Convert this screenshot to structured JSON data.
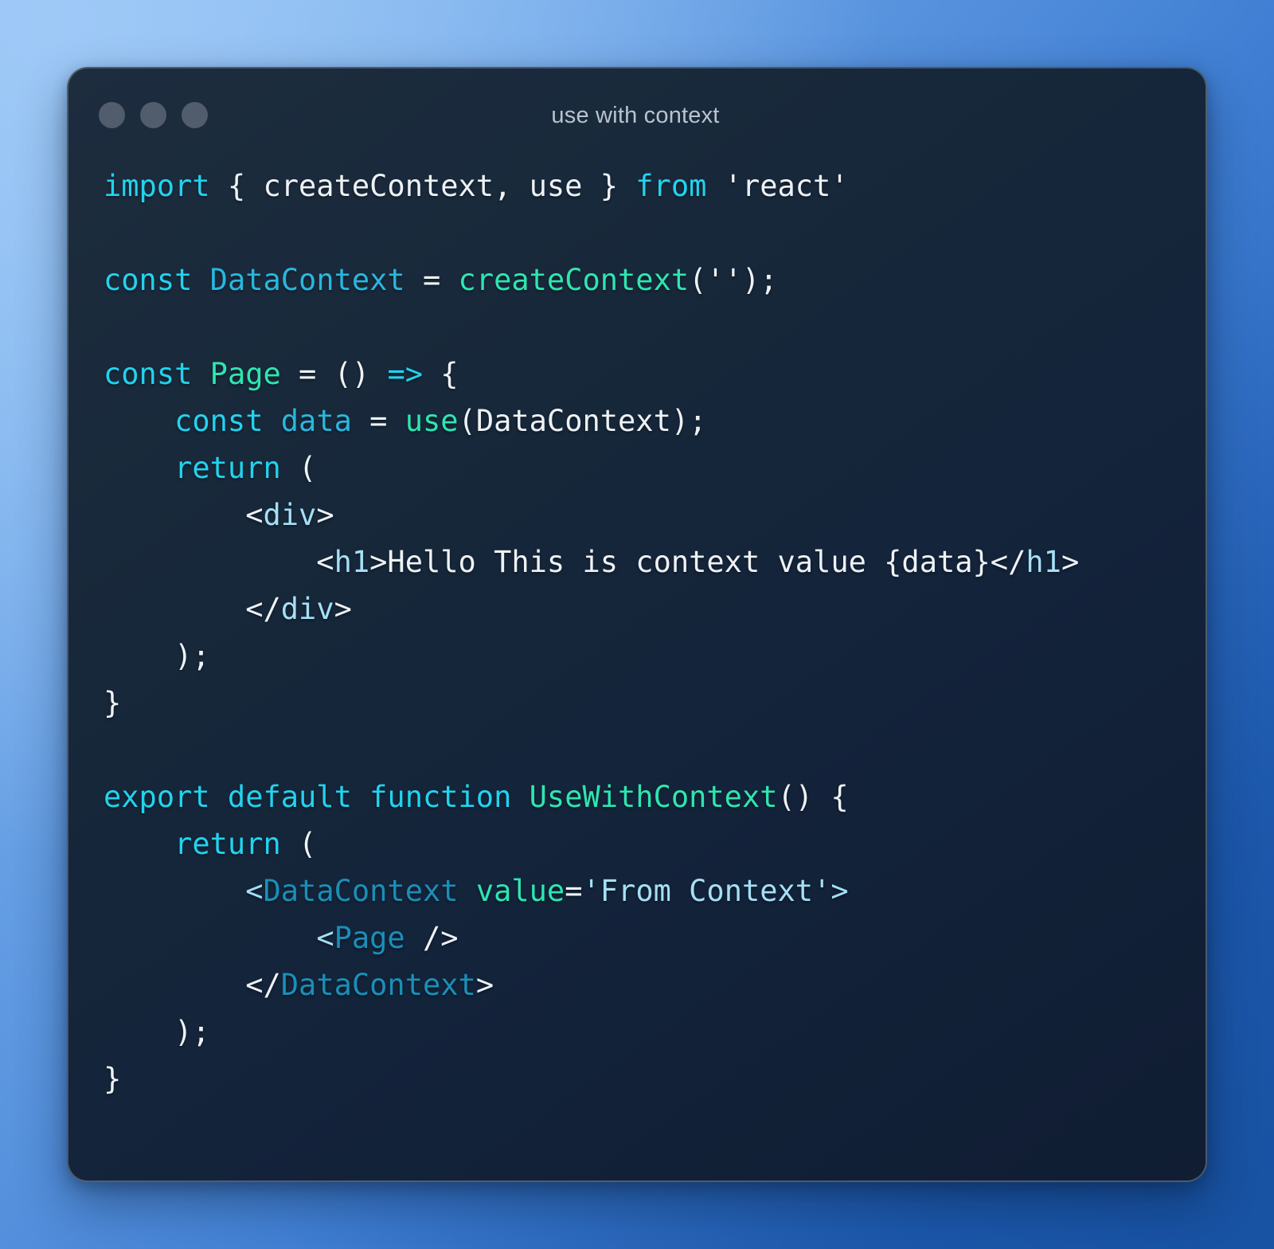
{
  "window": {
    "title": "use with context",
    "traffic_lights": [
      "close-dot",
      "minimize-dot",
      "maximize-dot"
    ]
  },
  "colors": {
    "window_bg": "#17283a",
    "backdrop_from": "#8cbdf2",
    "backdrop_to": "#1a56ad",
    "dot": "#515d6c",
    "title_text": "#b9c3ce",
    "keyword": "#22d3ee",
    "function": "#2ee6b0",
    "variable": "#2ab7dd",
    "jsx_tag": "#a5dff5",
    "jsx_component": "#1a8fb8",
    "plain": "#eef2f6"
  },
  "code": {
    "language": "jsx",
    "plain_text": "import { createContext, use } from 'react'\n\nconst DataContext = createContext('');\n\nconst Page = () => {\n    const data = use(DataContext);\n    return (\n        <div>\n            <h1>Hello This is context value {data}</h1>\n        </div>\n    );\n}\n\nexport default function UseWithContext() {\n    return (\n        <DataContext value='From Context'>\n            <Page />\n        </DataContext>\n    );\n}",
    "lines": [
      {
        "n": 1,
        "tokens": [
          {
            "t": "import",
            "c": "tok-kw"
          },
          {
            "t": " { createContext, use } ",
            "c": "tok-plain"
          },
          {
            "t": "from",
            "c": "tok-kw"
          },
          {
            "t": " 'react'",
            "c": "tok-plain"
          }
        ]
      },
      {
        "n": 2,
        "tokens": []
      },
      {
        "n": 3,
        "tokens": [
          {
            "t": "const",
            "c": "tok-kw"
          },
          {
            "t": " ",
            "c": "tok-plain"
          },
          {
            "t": "DataContext",
            "c": "tok-var"
          },
          {
            "t": " = ",
            "c": "tok-plain"
          },
          {
            "t": "createContext",
            "c": "tok-fn"
          },
          {
            "t": "('');",
            "c": "tok-plain"
          }
        ]
      },
      {
        "n": 4,
        "tokens": []
      },
      {
        "n": 5,
        "tokens": [
          {
            "t": "const",
            "c": "tok-kw"
          },
          {
            "t": " ",
            "c": "tok-plain"
          },
          {
            "t": "Page",
            "c": "tok-fn"
          },
          {
            "t": " = () ",
            "c": "tok-plain"
          },
          {
            "t": "=>",
            "c": "tok-kw"
          },
          {
            "t": " {",
            "c": "tok-plain"
          }
        ]
      },
      {
        "n": 6,
        "tokens": [
          {
            "t": "    ",
            "c": "tok-plain"
          },
          {
            "t": "const",
            "c": "tok-kw"
          },
          {
            "t": " ",
            "c": "tok-plain"
          },
          {
            "t": "data",
            "c": "tok-var"
          },
          {
            "t": " = ",
            "c": "tok-plain"
          },
          {
            "t": "use",
            "c": "tok-fn"
          },
          {
            "t": "(DataContext);",
            "c": "tok-plain"
          }
        ]
      },
      {
        "n": 7,
        "tokens": [
          {
            "t": "    ",
            "c": "tok-plain"
          },
          {
            "t": "return",
            "c": "tok-kw"
          },
          {
            "t": " (",
            "c": "tok-plain"
          }
        ]
      },
      {
        "n": 8,
        "tokens": [
          {
            "t": "        <",
            "c": "tok-plain"
          },
          {
            "t": "div",
            "c": "tok-tag"
          },
          {
            "t": ">",
            "c": "tok-plain"
          }
        ]
      },
      {
        "n": 9,
        "tokens": [
          {
            "t": "            <",
            "c": "tok-plain"
          },
          {
            "t": "h1",
            "c": "tok-tag"
          },
          {
            "t": ">Hello This is context value {data}</",
            "c": "tok-plain"
          },
          {
            "t": "h1",
            "c": "tok-tag"
          },
          {
            "t": ">",
            "c": "tok-plain"
          }
        ]
      },
      {
        "n": 10,
        "tokens": [
          {
            "t": "        </",
            "c": "tok-plain"
          },
          {
            "t": "div",
            "c": "tok-tag"
          },
          {
            "t": ">",
            "c": "tok-plain"
          }
        ]
      },
      {
        "n": 11,
        "tokens": [
          {
            "t": "    );",
            "c": "tok-plain"
          }
        ]
      },
      {
        "n": 12,
        "tokens": [
          {
            "t": "}",
            "c": "tok-plain"
          }
        ]
      },
      {
        "n": 13,
        "tokens": []
      },
      {
        "n": 14,
        "tokens": [
          {
            "t": "export default function",
            "c": "tok-kw"
          },
          {
            "t": " ",
            "c": "tok-plain"
          },
          {
            "t": "UseWithContext",
            "c": "tok-fn"
          },
          {
            "t": "() {",
            "c": "tok-plain"
          }
        ]
      },
      {
        "n": 15,
        "tokens": [
          {
            "t": "    ",
            "c": "tok-plain"
          },
          {
            "t": "return",
            "c": "tok-kw"
          },
          {
            "t": " (",
            "c": "tok-plain"
          }
        ]
      },
      {
        "n": 16,
        "tokens": [
          {
            "t": "        ",
            "c": "tok-plain"
          },
          {
            "t": "<",
            "c": "tok-tag"
          },
          {
            "t": "DataContext",
            "c": "tok-comp"
          },
          {
            "t": " ",
            "c": "tok-plain"
          },
          {
            "t": "value",
            "c": "tok-attr"
          },
          {
            "t": "=",
            "c": "tok-plain"
          },
          {
            "t": "'From Context'",
            "c": "tok-tag"
          },
          {
            "t": ">",
            "c": "tok-tag"
          }
        ]
      },
      {
        "n": 17,
        "tokens": [
          {
            "t": "            ",
            "c": "tok-plain"
          },
          {
            "t": "<",
            "c": "tok-tag"
          },
          {
            "t": "Page",
            "c": "tok-comp"
          },
          {
            "t": " />",
            "c": "tok-plain"
          }
        ]
      },
      {
        "n": 18,
        "tokens": [
          {
            "t": "        </",
            "c": "tok-plain"
          },
          {
            "t": "DataContext",
            "c": "tok-comp"
          },
          {
            "t": ">",
            "c": "tok-plain"
          }
        ]
      },
      {
        "n": 19,
        "tokens": [
          {
            "t": "    );",
            "c": "tok-plain"
          }
        ]
      },
      {
        "n": 20,
        "tokens": [
          {
            "t": "}",
            "c": "tok-plain"
          }
        ]
      }
    ]
  }
}
